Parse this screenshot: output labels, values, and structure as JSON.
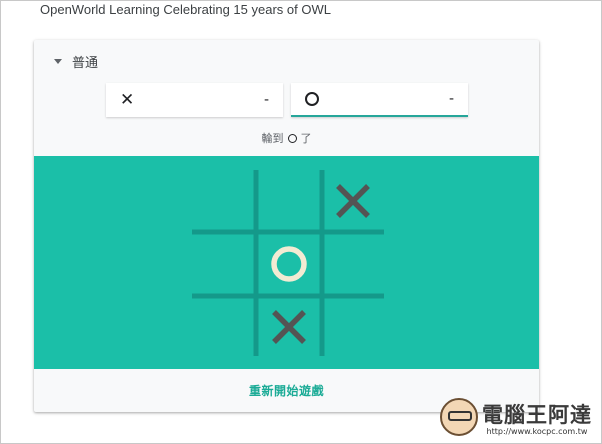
{
  "header": {
    "text": "OpenWorld Learning Celebrating 15 years of OWL"
  },
  "game": {
    "difficulty": "普通",
    "players": {
      "x": {
        "mark": "✕",
        "score": "-"
      },
      "o": {
        "mark": "O",
        "score": "-"
      }
    },
    "turn": {
      "prefix": "輪到",
      "suffix": "了"
    },
    "board": [
      [
        "",
        "",
        "X"
      ],
      [
        "",
        "O",
        ""
      ],
      [
        "",
        "X",
        ""
      ]
    ],
    "restart_label": "重新開始遊戲"
  },
  "colors": {
    "board_bg": "#1bbfa8",
    "grid": "#14998a",
    "x_mark": "#545454",
    "o_mark": "#f2ebd3",
    "accent": "#26a69a"
  },
  "watermark": {
    "title": "電腦王阿達",
    "url": "http://www.kocpc.com.tw"
  }
}
